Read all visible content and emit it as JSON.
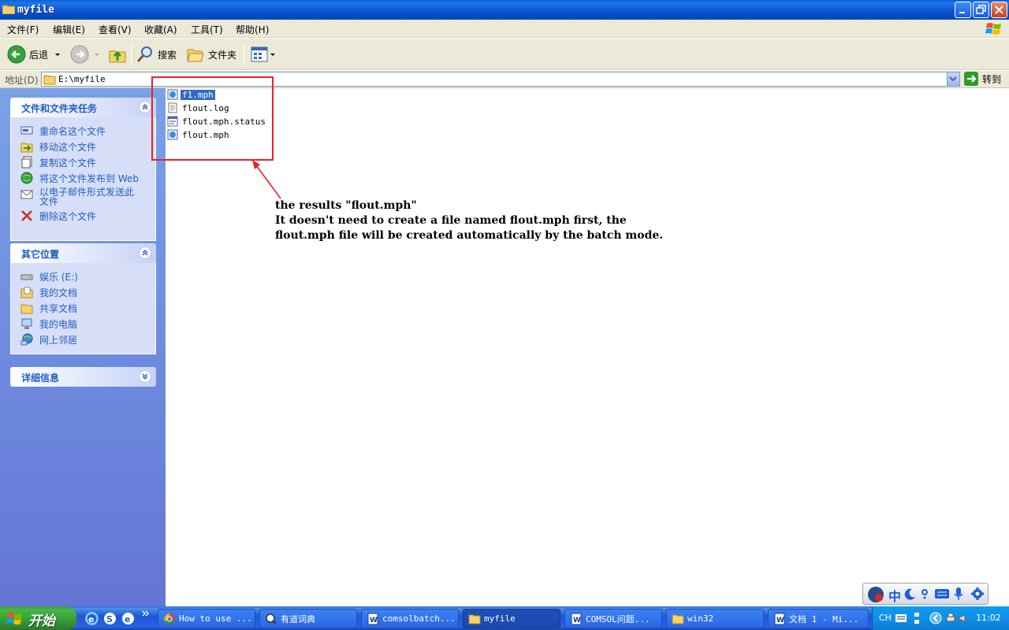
{
  "window": {
    "title": "myfile"
  },
  "menu": [
    "文件(F)",
    "编辑(E)",
    "查看(V)",
    "收藏(A)",
    "工具(T)",
    "帮助(H)"
  ],
  "toolbar": {
    "back": "后退",
    "search": "搜索",
    "folders": "文件夹"
  },
  "address": {
    "label": "地址(D)",
    "path": "E:\\myfile",
    "go": "转到"
  },
  "tasks": {
    "title": "文件和文件夹任务",
    "items": [
      "重命名这个文件",
      "移动这个文件",
      "复制这个文件",
      "将这个文件发布到 Web",
      "以电子邮件形式发送此",
      "文件",
      "删除这个文件"
    ]
  },
  "places": {
    "title": "其它位置",
    "items": [
      "娱乐 (E:)",
      "我的文档",
      "共享文档",
      "我的电脑",
      "网上邻居"
    ]
  },
  "details": {
    "title": "详细信息"
  },
  "files": [
    {
      "name": "f1.mph",
      "selected": true
    },
    {
      "name": "flout.log",
      "selected": false
    },
    {
      "name": "flout.mph.status",
      "selected": false
    },
    {
      "name": "flout.mph",
      "selected": false
    }
  ],
  "annotation": {
    "line1": "the results \"flout.mph\"",
    "line2": "It doesn't need to create a file named flout.mph first, the",
    "line3": "flout.mph file will be created automatically by the batch mode.",
    "color": "#e8222b"
  },
  "taskbar": {
    "start": "开始",
    "buttons": [
      "How to use ...",
      "有道词典",
      "comsolbatch...",
      "myfile",
      "COMSOL问题...",
      "win32",
      "文档 1 - Mi..."
    ],
    "lang": "CH",
    "clock": "11:02"
  },
  "langbar": {
    "mode": "中"
  }
}
